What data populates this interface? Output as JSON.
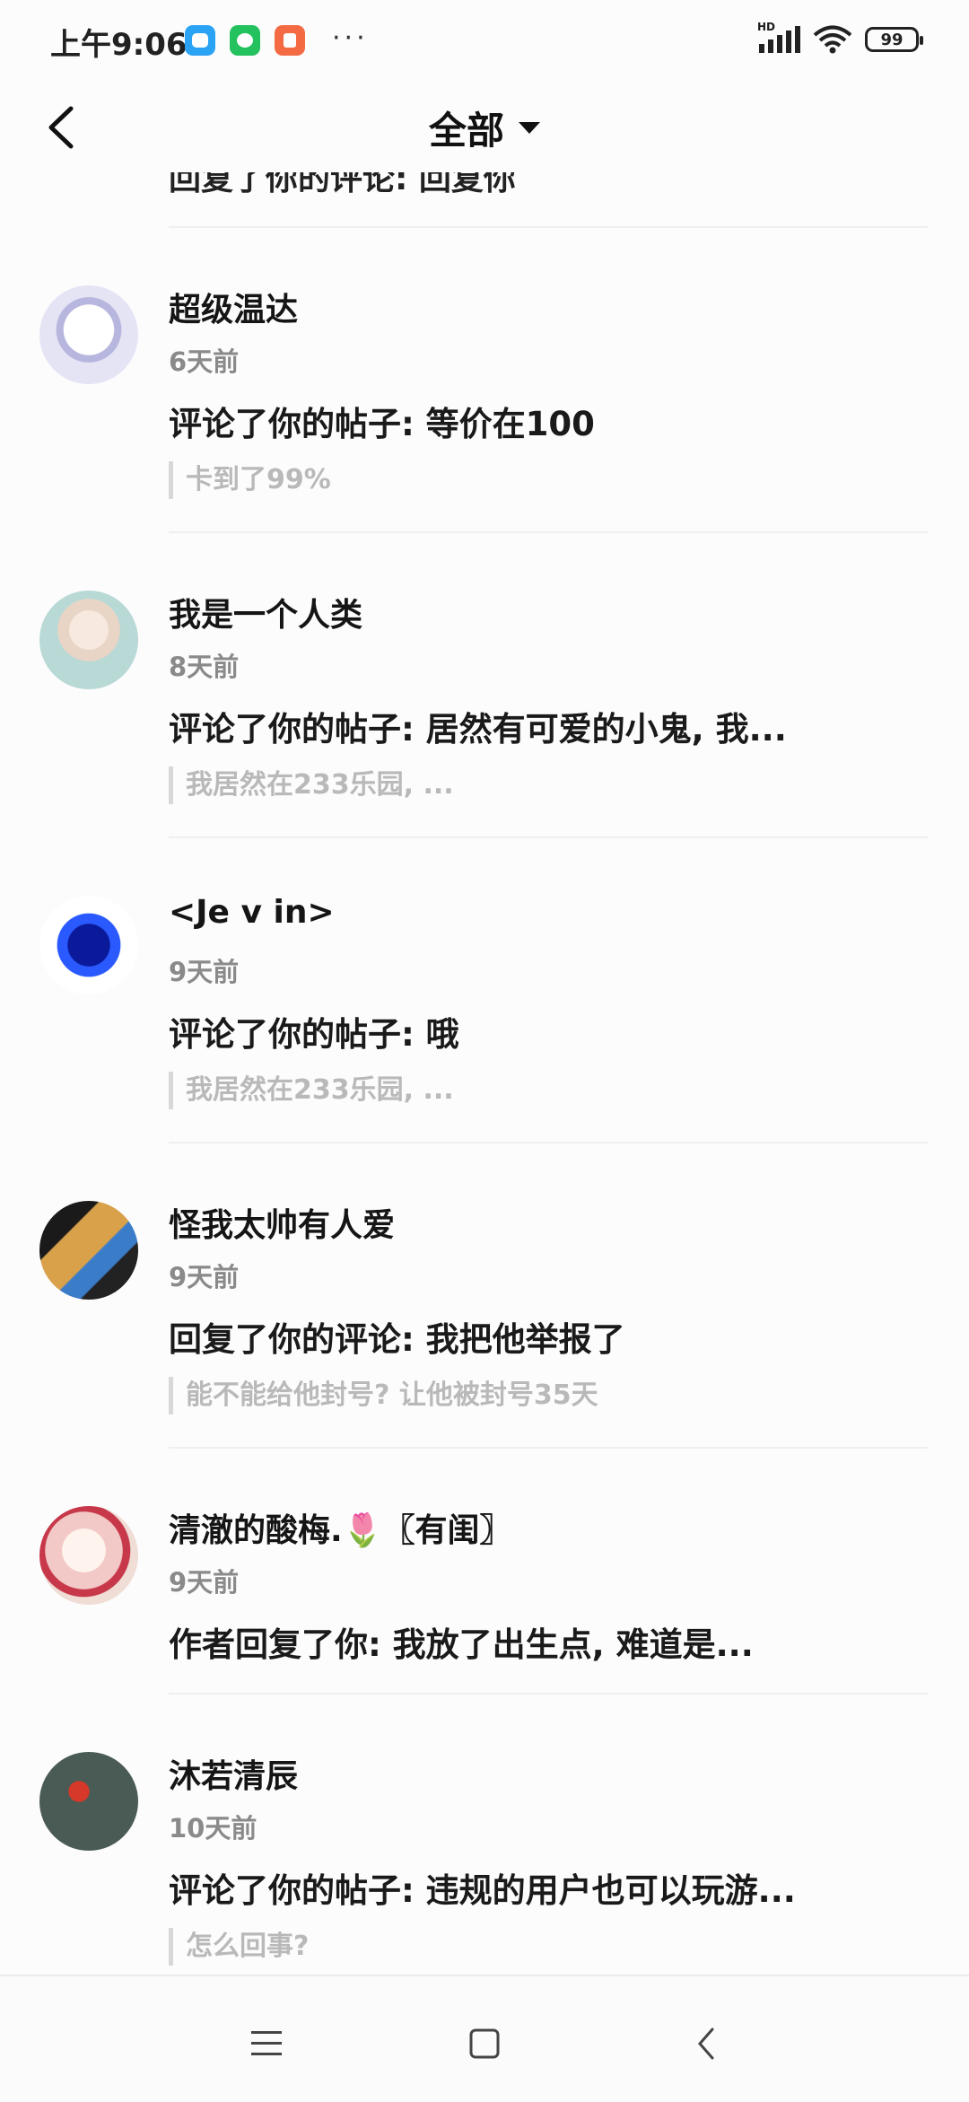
{
  "status_bar": {
    "time": "上午9:06",
    "network": "HD",
    "battery": "99"
  },
  "header": {
    "title": "全部"
  },
  "partial_item": {
    "text": "回复了你的评论: 回复你"
  },
  "items": [
    {
      "name": "超级温达",
      "time": "6天前",
      "action": "评论了你的帖子: 等价在100",
      "quote": "卡到了99%",
      "avatar_color": "#d6d7ef"
    },
    {
      "name": "我是一个人类",
      "time": "8天前",
      "action": "评论了你的帖子: 居然有可爱的小鬼, 我...",
      "quote": "我居然在233乐园, ...",
      "avatar_color": "#b9d9d6"
    },
    {
      "name": "<Je v in>",
      "time": "9天前",
      "action": "评论了你的帖子: 哦",
      "quote": "我居然在233乐园, ...",
      "avatar_color": "#1d3fcf"
    },
    {
      "name": "怪我太帅有人爱",
      "time": "9天前",
      "action": "回复了你的评论: 我把他举报了",
      "quote": "能不能给他封号? 让他被封号35天",
      "avatar_color": "#c9922d"
    },
    {
      "name": "清澈的酸梅.🌷〖有闺〗",
      "time": "9天前",
      "action": "作者回复了你: 我放了出生点, 难道是...",
      "quote": "",
      "avatar_color": "#f2c9c6"
    },
    {
      "name": "沐若清辰",
      "time": "10天前",
      "action": "评论了你的帖子: 违规的用户也可以玩游...",
      "quote": "怎么回事?",
      "avatar_color": "#4a5a54"
    }
  ]
}
